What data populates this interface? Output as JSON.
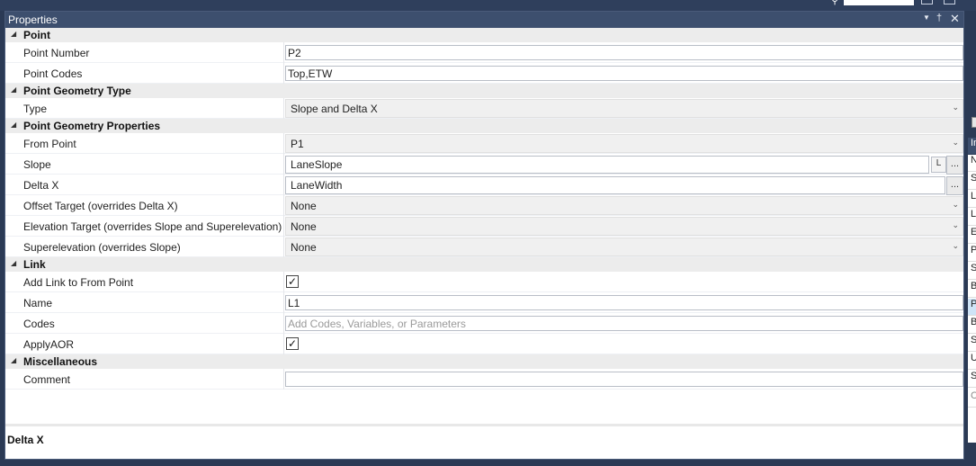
{
  "panel": {
    "title": "Properties",
    "header_icons": [
      "dropdown-arrow-icon",
      "pin-icon",
      "close-icon"
    ]
  },
  "categories": [
    {
      "label": "Point"
    },
    {
      "label": "Point Geometry Type"
    },
    {
      "label": "Point Geometry Properties"
    },
    {
      "label": "Link"
    },
    {
      "label": "Miscellaneous"
    }
  ],
  "rows": {
    "point_number": {
      "name": "Point Number",
      "value": "P2"
    },
    "point_codes": {
      "name": "Point Codes",
      "value": "Top,ETW"
    },
    "type": {
      "name": "Type",
      "value": "Slope and Delta X"
    },
    "from_point": {
      "name": "From Point",
      "value": "P1"
    },
    "slope": {
      "name": "Slope",
      "value": "LaneSlope",
      "mini": "L",
      "ellipsis": "..."
    },
    "delta_x": {
      "name": "Delta X",
      "value": "LaneWidth",
      "ellipsis": "..."
    },
    "offset_target": {
      "name": "Offset Target (overrides Delta X)",
      "value": "None"
    },
    "elevation_target": {
      "name": "Elevation Target (overrides Slope and Superelevation)",
      "value": "None"
    },
    "superelevation": {
      "name": "Superelevation (overrides Slope)",
      "value": "None"
    },
    "add_link": {
      "name": "Add Link to From Point",
      "checked": true
    },
    "link_name": {
      "name": "Name",
      "value": "L1"
    },
    "codes": {
      "name": "Codes",
      "placeholder": "Add Codes, Variables, or Parameters"
    },
    "apply_aor": {
      "name": "ApplyAOR",
      "checked": true
    },
    "comment": {
      "name": "Comment",
      "value": ""
    }
  },
  "description": {
    "title": "Delta X"
  },
  "right_panel": {
    "header": "In",
    "items": [
      "N",
      "S",
      "L",
      "L",
      "E",
      "P",
      "S",
      "B",
      "P",
      "B",
      "S",
      "U",
      "S",
      "C"
    ]
  },
  "colors": {
    "frame": "#2b3a55",
    "header": "#3d4f6e",
    "category_bg": "#ececec",
    "selected": "#cfe4f7"
  }
}
